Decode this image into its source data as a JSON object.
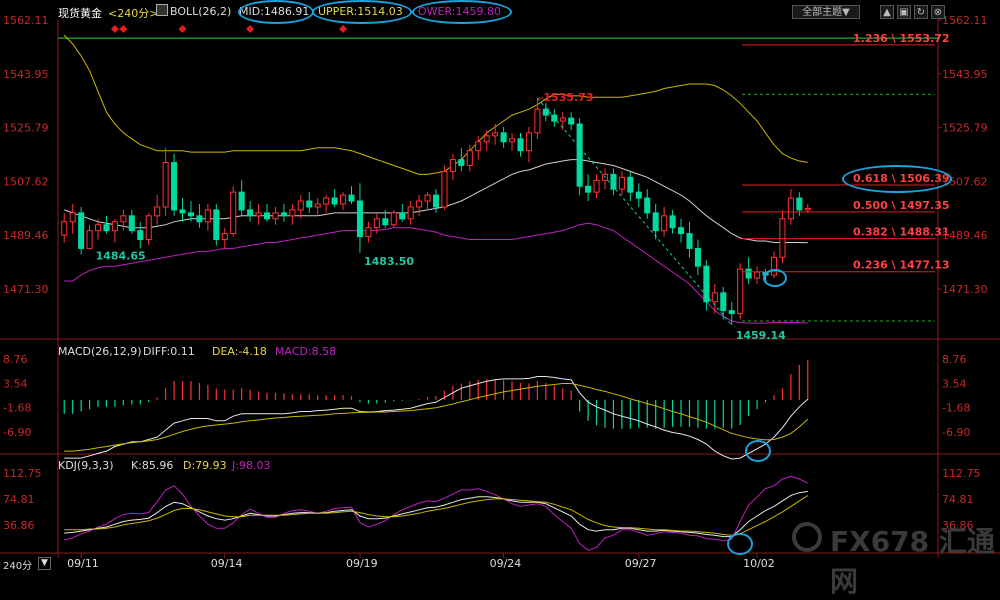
{
  "header": {
    "instrument": "现货黄金",
    "period": "<240分>",
    "indicator_name": "BOLL(26,2)",
    "mid_label": "MID:1486.91",
    "upper_label": "UPPER:1514.03",
    "lower_label": "OWER:1459.80"
  },
  "toolbar": {
    "topic_button": "全部主题▼",
    "button2": "▲",
    "button3": "▣",
    "button4": "↻",
    "button5": "⊗"
  },
  "macd": {
    "label": "MACD(26,12,9)",
    "diff": "DIFF:0.11",
    "dea": "DEA:-4.18",
    "macd": "MACD:8.58"
  },
  "kdj": {
    "label": "KDJ(9,3,3)",
    "k": "K:85.96",
    "d": "D:79.93",
    "j": "J:98.03"
  },
  "period_selector": "240分",
  "watermark": "FX678 汇通网",
  "colors": {
    "up": "#ff3232",
    "down": "#00d9a0",
    "mid": "#cfcfcf",
    "upper": "#c8b800",
    "lower": "#c020c0",
    "axis_text": "#c82828"
  },
  "chart_data": {
    "type": "candlestick",
    "price_axis_ticks": [
      "1562.11",
      "1543.95",
      "1525.79",
      "1507.62",
      "1489.46",
      "1471.30"
    ],
    "macd_axis_ticks": [
      "8.76",
      "3.54",
      "-1.68",
      "-6.90"
    ],
    "kdj_axis_ticks": [
      "112.75",
      "74.81",
      "36.86"
    ],
    "date_labels": [
      "09/11",
      "09/14",
      "09/19",
      "09/24",
      "09/27",
      "10/02"
    ],
    "annotations": {
      "high": "1535.73",
      "low1": "1484.65",
      "low2": "1483.50",
      "low3": "1459.14"
    },
    "fib_levels": [
      {
        "label": "1.236 \\ 1553.72",
        "price": 1553.72
      },
      {
        "label": "0.618 \\ 1506.39",
        "price": 1506.39
      },
      {
        "label": "0.500 \\ 1497.35",
        "price": 1497.35
      },
      {
        "label": "0.382 \\ 1488.31",
        "price": 1488.31
      },
      {
        "label": "0.236 \\ 1477.13",
        "price": 1477.13
      }
    ],
    "green_level": 1556.0,
    "dashed_levels": [
      1537.0,
      1460.5
    ],
    "candles": [
      {
        "o": 1489.5,
        "h": 1497,
        "l": 1487,
        "c": 1494
      },
      {
        "o": 1494,
        "h": 1500,
        "l": 1490,
        "c": 1497
      },
      {
        "o": 1497,
        "h": 1499,
        "l": 1483,
        "c": 1485
      },
      {
        "o": 1485,
        "h": 1493,
        "l": 1484.65,
        "c": 1491
      },
      {
        "o": 1491,
        "h": 1495,
        "l": 1488,
        "c": 1493
      },
      {
        "o": 1493,
        "h": 1496,
        "l": 1490,
        "c": 1491
      },
      {
        "o": 1491,
        "h": 1495,
        "l": 1487,
        "c": 1494
      },
      {
        "o": 1494,
        "h": 1498,
        "l": 1491,
        "c": 1496
      },
      {
        "o": 1496,
        "h": 1498,
        "l": 1490,
        "c": 1491
      },
      {
        "o": 1491,
        "h": 1494,
        "l": 1485,
        "c": 1488
      },
      {
        "o": 1488,
        "h": 1497,
        "l": 1486,
        "c": 1496
      },
      {
        "o": 1496,
        "h": 1503,
        "l": 1493,
        "c": 1499
      },
      {
        "o": 1499,
        "h": 1519,
        "l": 1496,
        "c": 1514
      },
      {
        "o": 1514,
        "h": 1517,
        "l": 1496,
        "c": 1498
      },
      {
        "o": 1498,
        "h": 1502,
        "l": 1494,
        "c": 1497
      },
      {
        "o": 1497,
        "h": 1501,
        "l": 1494,
        "c": 1496
      },
      {
        "o": 1496,
        "h": 1500,
        "l": 1492,
        "c": 1494
      },
      {
        "o": 1494,
        "h": 1500,
        "l": 1491,
        "c": 1498
      },
      {
        "o": 1498,
        "h": 1500,
        "l": 1486,
        "c": 1488
      },
      {
        "o": 1488,
        "h": 1492,
        "l": 1485,
        "c": 1490
      },
      {
        "o": 1490,
        "h": 1506,
        "l": 1489,
        "c": 1504
      },
      {
        "o": 1504,
        "h": 1508,
        "l": 1496,
        "c": 1498
      },
      {
        "o": 1498,
        "h": 1501,
        "l": 1494,
        "c": 1496
      },
      {
        "o": 1496,
        "h": 1500,
        "l": 1493,
        "c": 1497
      },
      {
        "o": 1497,
        "h": 1500,
        "l": 1494,
        "c": 1495
      },
      {
        "o": 1495,
        "h": 1499,
        "l": 1493,
        "c": 1497
      },
      {
        "o": 1497,
        "h": 1500,
        "l": 1494,
        "c": 1496
      },
      {
        "o": 1496,
        "h": 1500,
        "l": 1493,
        "c": 1498
      },
      {
        "o": 1498,
        "h": 1503,
        "l": 1495,
        "c": 1501
      },
      {
        "o": 1501,
        "h": 1504,
        "l": 1497,
        "c": 1499
      },
      {
        "o": 1499,
        "h": 1502,
        "l": 1496,
        "c": 1500
      },
      {
        "o": 1500,
        "h": 1503,
        "l": 1497,
        "c": 1502
      },
      {
        "o": 1502,
        "h": 1505,
        "l": 1499,
        "c": 1500
      },
      {
        "o": 1500,
        "h": 1504,
        "l": 1498,
        "c": 1503
      },
      {
        "o": 1503,
        "h": 1506,
        "l": 1500,
        "c": 1501
      },
      {
        "o": 1501,
        "h": 1507,
        "l": 1483.5,
        "c": 1489
      },
      {
        "o": 1489,
        "h": 1494,
        "l": 1487,
        "c": 1492
      },
      {
        "o": 1492,
        "h": 1497,
        "l": 1490,
        "c": 1495
      },
      {
        "o": 1495,
        "h": 1498,
        "l": 1492,
        "c": 1493
      },
      {
        "o": 1493,
        "h": 1498,
        "l": 1492,
        "c": 1497
      },
      {
        "o": 1497,
        "h": 1500,
        "l": 1494,
        "c": 1495
      },
      {
        "o": 1495,
        "h": 1501,
        "l": 1493,
        "c": 1499
      },
      {
        "o": 1499,
        "h": 1503,
        "l": 1496,
        "c": 1501
      },
      {
        "o": 1501,
        "h": 1504,
        "l": 1498,
        "c": 1503
      },
      {
        "o": 1503,
        "h": 1505,
        "l": 1497,
        "c": 1499
      },
      {
        "o": 1499,
        "h": 1513,
        "l": 1498,
        "c": 1511
      },
      {
        "o": 1511,
        "h": 1517,
        "l": 1508,
        "c": 1515
      },
      {
        "o": 1515,
        "h": 1519,
        "l": 1511,
        "c": 1513
      },
      {
        "o": 1513,
        "h": 1520,
        "l": 1511,
        "c": 1518
      },
      {
        "o": 1518,
        "h": 1523,
        "l": 1515,
        "c": 1521
      },
      {
        "o": 1521,
        "h": 1525,
        "l": 1518,
        "c": 1523
      },
      {
        "o": 1523,
        "h": 1527,
        "l": 1520,
        "c": 1524
      },
      {
        "o": 1524,
        "h": 1526,
        "l": 1519,
        "c": 1521
      },
      {
        "o": 1521,
        "h": 1524,
        "l": 1518,
        "c": 1522
      },
      {
        "o": 1522,
        "h": 1524,
        "l": 1516,
        "c": 1518
      },
      {
        "o": 1518,
        "h": 1526,
        "l": 1514,
        "c": 1524
      },
      {
        "o": 1524,
        "h": 1535.73,
        "l": 1522,
        "c": 1532
      },
      {
        "o": 1532,
        "h": 1534,
        "l": 1528,
        "c": 1530
      },
      {
        "o": 1530,
        "h": 1532,
        "l": 1526,
        "c": 1528
      },
      {
        "o": 1528,
        "h": 1531,
        "l": 1525,
        "c": 1529
      },
      {
        "o": 1529,
        "h": 1531,
        "l": 1525,
        "c": 1527
      },
      {
        "o": 1527,
        "h": 1529,
        "l": 1503,
        "c": 1506
      },
      {
        "o": 1506,
        "h": 1510,
        "l": 1501,
        "c": 1504
      },
      {
        "o": 1504,
        "h": 1510,
        "l": 1502,
        "c": 1508
      },
      {
        "o": 1508,
        "h": 1512,
        "l": 1505,
        "c": 1510
      },
      {
        "o": 1510,
        "h": 1512,
        "l": 1503,
        "c": 1505
      },
      {
        "o": 1505,
        "h": 1511,
        "l": 1503,
        "c": 1509
      },
      {
        "o": 1509,
        "h": 1511,
        "l": 1501,
        "c": 1504
      },
      {
        "o": 1504,
        "h": 1507,
        "l": 1499,
        "c": 1502
      },
      {
        "o": 1502,
        "h": 1505,
        "l": 1495,
        "c": 1497
      },
      {
        "o": 1497,
        "h": 1500,
        "l": 1488,
        "c": 1491
      },
      {
        "o": 1491,
        "h": 1499,
        "l": 1489,
        "c": 1496
      },
      {
        "o": 1496,
        "h": 1498,
        "l": 1490,
        "c": 1492
      },
      {
        "o": 1492,
        "h": 1495,
        "l": 1487,
        "c": 1490
      },
      {
        "o": 1490,
        "h": 1494,
        "l": 1482,
        "c": 1485
      },
      {
        "o": 1485,
        "h": 1488,
        "l": 1476,
        "c": 1479
      },
      {
        "o": 1479,
        "h": 1481,
        "l": 1464,
        "c": 1467
      },
      {
        "o": 1467,
        "h": 1473,
        "l": 1463,
        "c": 1470
      },
      {
        "o": 1470,
        "h": 1472,
        "l": 1461,
        "c": 1464
      },
      {
        "o": 1464,
        "h": 1467,
        "l": 1459.14,
        "c": 1463
      },
      {
        "o": 1463,
        "h": 1480,
        "l": 1461,
        "c": 1478
      },
      {
        "o": 1478,
        "h": 1482,
        "l": 1473,
        "c": 1475
      },
      {
        "o": 1475,
        "h": 1479,
        "l": 1473,
        "c": 1477
      },
      {
        "o": 1477,
        "h": 1478,
        "l": 1474,
        "c": 1476
      },
      {
        "o": 1476,
        "h": 1484,
        "l": 1475,
        "c": 1482
      },
      {
        "o": 1482,
        "h": 1498,
        "l": 1480,
        "c": 1495
      },
      {
        "o": 1495,
        "h": 1505,
        "l": 1493,
        "c": 1502
      },
      {
        "o": 1502,
        "h": 1504,
        "l": 1496,
        "c": 1498
      },
      {
        "o": 1498,
        "h": 1500,
        "l": 1497,
        "c": 1498.5
      }
    ],
    "boll_mid": [
      1498,
      1497,
      1496,
      1495,
      1494,
      1493.5,
      1493,
      1492.5,
      1492,
      1492,
      1492,
      1492.5,
      1493,
      1494,
      1494.5,
      1495,
      1495,
      1495,
      1495,
      1495,
      1495.5,
      1496,
      1496,
      1496,
      1496,
      1496,
      1496,
      1496,
      1496,
      1496,
      1496,
      1496.5,
      1497,
      1497,
      1497,
      1497,
      1497,
      1497,
      1497,
      1497,
      1497,
      1497,
      1497.5,
      1498,
      1498.5,
      1499,
      1500,
      1501,
      1502.5,
      1504,
      1505.5,
      1507,
      1508.5,
      1510,
      1511,
      1511.5,
      1512.5,
      1513.5,
      1514,
      1514.5,
      1515,
      1515,
      1514.5,
      1514,
      1513.5,
      1513,
      1512,
      1511,
      1510,
      1509,
      1507.5,
      1506,
      1504.5,
      1503,
      1501,
      1498.5,
      1496,
      1494,
      1492,
      1490,
      1488.5,
      1488,
      1487.5,
      1487.5,
      1487,
      1487,
      1487,
      1487,
      1486.91
    ],
    "boll_upper": [
      1557,
      1554,
      1550,
      1545,
      1538,
      1531,
      1527,
      1524,
      1522,
      1520,
      1519,
      1518,
      1518,
      1518,
      1518,
      1517.5,
      1517.5,
      1517.5,
      1517.5,
      1517.5,
      1518,
      1518,
      1518,
      1518,
      1518,
      1518,
      1518,
      1518,
      1518,
      1518.5,
      1519,
      1519,
      1519,
      1518.5,
      1518,
      1517,
      1516,
      1515,
      1514,
      1513,
      1512,
      1511,
      1510,
      1510,
      1510.5,
      1511,
      1513,
      1515,
      1518,
      1521,
      1524,
      1526,
      1528,
      1530,
      1531,
      1532,
      1533.5,
      1535.5,
      1537,
      1537,
      1536.5,
      1536.5,
      1536,
      1536,
      1536,
      1536,
      1536,
      1536.5,
      1537,
      1537.5,
      1538,
      1539,
      1539.5,
      1540,
      1540.5,
      1540.5,
      1540.5,
      1540,
      1538.5,
      1536.5,
      1534,
      1531,
      1528,
      1524,
      1520,
      1517,
      1515.5,
      1514.5,
      1514.03
    ],
    "boll_lower": [
      1474,
      1474,
      1476,
      1477.5,
      1478.5,
      1479,
      1479,
      1479.5,
      1480,
      1480.5,
      1481,
      1481.5,
      1482,
      1482.5,
      1483,
      1483.5,
      1484,
      1484,
      1484.5,
      1485,
      1485,
      1485.5,
      1486,
      1486.5,
      1487,
      1487,
      1487.5,
      1488,
      1488.5,
      1489,
      1489.5,
      1490,
      1490.5,
      1491,
      1491,
      1491,
      1491,
      1491,
      1491.5,
      1492,
      1492,
      1492,
      1491.5,
      1491,
      1490.5,
      1489.5,
      1489,
      1488.5,
      1488,
      1488,
      1488,
      1488,
      1488,
      1488,
      1488.5,
      1489,
      1489.5,
      1490,
      1490.5,
      1491,
      1492,
      1493,
      1493.5,
      1493,
      1492,
      1491,
      1489,
      1487,
      1485,
      1483,
      1481,
      1479,
      1477,
      1475,
      1473,
      1470,
      1467,
      1464,
      1462,
      1460.5,
      1460,
      1459.8,
      1459.8,
      1459.8,
      1460,
      1460,
      1460,
      1460,
      1459.8
    ],
    "macd_hist": [
      -3,
      -3,
      -2.5,
      -2,
      -1.5,
      -1.5,
      -1.5,
      -1.2,
      -1,
      -1,
      -0.5,
      0.5,
      2.5,
      4,
      4,
      4,
      3.6,
      3.2,
      2.4,
      2.2,
      2.2,
      2.6,
      2.2,
      1.8,
      1.5,
      1.5,
      1.4,
      1.2,
      1.2,
      1.2,
      1.0,
      1.0,
      1.0,
      1.0,
      0.8,
      -0.5,
      -0.8,
      -0.8,
      -0.6,
      -0.3,
      -0.2,
      -0.1,
      0.2,
      0.6,
      0.8,
      2.0,
      3.0,
      3.5,
      4.0,
      4.3,
      4.4,
      4.4,
      4.2,
      4.0,
      3.6,
      3.5,
      4.0,
      3.6,
      3.0,
      2.5,
      2.0,
      -2.5,
      -4.5,
      -5.5,
      -6,
      -6.2,
      -6.2,
      -6.2,
      -6,
      -6,
      -6.2,
      -6,
      -5.8,
      -5.8,
      -5.8,
      -6,
      -6.2,
      -6.2,
      -6,
      -6.2,
      -5.4,
      -3.5,
      -2,
      -0.5,
      1.0,
      2.5,
      5.5,
      7.5,
      8.58
    ],
    "macd_diff": [
      -12.5,
      -12.5,
      -12.5,
      -12,
      -11.5,
      -11,
      -10,
      -9.5,
      -9,
      -9,
      -8.5,
      -8,
      -6.5,
      -5,
      -4.5,
      -4,
      -4,
      -4,
      -4.5,
      -4.5,
      -3.5,
      -3,
      -3,
      -3,
      -3,
      -3,
      -3,
      -2.8,
      -2.5,
      -2.5,
      -2.3,
      -2.2,
      -2,
      -1.8,
      -1.8,
      -2.5,
      -2.6,
      -2.5,
      -2.3,
      -2.2,
      -2,
      -1.8,
      -1.3,
      -0.8,
      -0.5,
      0.5,
      1.5,
      2.5,
      3,
      3.5,
      4,
      4.3,
      4.5,
      4.5,
      4.5,
      4.6,
      5,
      5,
      4.8,
      4.5,
      4.3,
      1.5,
      -0.5,
      -1.5,
      -2.2,
      -3,
      -3.5,
      -4,
      -4.5,
      -5.2,
      -5.8,
      -6.5,
      -7,
      -7.3,
      -7.8,
      -8.5,
      -9.5,
      -11,
      -12,
      -12.7,
      -12.5,
      -11.5,
      -10.5,
      -9.5,
      -8,
      -6,
      -3.5,
      -1.5,
      0.11
    ],
    "macd_dea": [
      -11,
      -11,
      -10.8,
      -10.6,
      -10.3,
      -10,
      -9.7,
      -9.4,
      -9.2,
      -9,
      -8.8,
      -8.5,
      -8,
      -7.4,
      -6.8,
      -6.3,
      -5.9,
      -5.6,
      -5.4,
      -5.2,
      -5,
      -4.7,
      -4.5,
      -4.3,
      -4.1,
      -3.9,
      -3.8,
      -3.6,
      -3.5,
      -3.4,
      -3.3,
      -3.2,
      -3,
      -2.9,
      -2.8,
      -2.7,
      -2.7,
      -2.6,
      -2.6,
      -2.5,
      -2.4,
      -2.3,
      -2.1,
      -1.9,
      -1.7,
      -1.3,
      -0.9,
      -0.4,
      0,
      0.5,
      0.9,
      1.3,
      1.7,
      2,
      2.3,
      2.6,
      2.9,
      3.1,
      3.3,
      3.5,
      3.5,
      3.1,
      2.7,
      2.2,
      1.8,
      1.3,
      0.8,
      0.2,
      -0.3,
      -0.8,
      -1.3,
      -1.9,
      -2.5,
      -3,
      -3.6,
      -4.2,
      -4.8,
      -5.6,
      -6.4,
      -7.2,
      -7.7,
      -8.1,
      -8.4,
      -8.6,
      -8.5,
      -8,
      -7.2,
      -5.8,
      -4.18
    ],
    "kdj_k": [
      25,
      26,
      28,
      30,
      32,
      34,
      38,
      42,
      44,
      45,
      47,
      55,
      64,
      70,
      68,
      62,
      56,
      50,
      46,
      44,
      46,
      50,
      54,
      52,
      50,
      50,
      52,
      54,
      55,
      55,
      54,
      55,
      57,
      58,
      59,
      50,
      46,
      46,
      47,
      50,
      53,
      56,
      59,
      62,
      63,
      66,
      70,
      74,
      76,
      78,
      78,
      77,
      75,
      72,
      70,
      70,
      70,
      68,
      62,
      56,
      50,
      38,
      30,
      28,
      30,
      30,
      32,
      32,
      30,
      28,
      28,
      29,
      28,
      27,
      26,
      25,
      23,
      22,
      20,
      20,
      30,
      42,
      50,
      58,
      64,
      72,
      80,
      84,
      85.96
    ],
    "kdj_d": [
      30,
      30,
      30,
      31,
      31,
      32,
      34,
      37,
      39,
      41,
      43,
      47,
      52,
      58,
      61,
      61,
      59,
      56,
      53,
      50,
      49,
      49,
      51,
      51,
      51,
      51,
      51,
      52,
      53,
      54,
      54,
      54,
      55,
      56,
      57,
      55,
      52,
      50,
      49,
      49,
      50,
      52,
      54,
      57,
      59,
      61,
      64,
      67,
      70,
      72,
      74,
      75,
      75,
      74,
      73,
      72,
      71,
      70,
      67,
      63,
      59,
      52,
      45,
      40,
      36,
      34,
      33,
      33,
      32,
      31,
      30,
      30,
      29,
      28,
      28,
      27,
      26,
      25,
      23,
      22,
      24,
      30,
      36,
      42,
      49,
      56,
      64,
      72,
      79.93
    ],
    "kdj_j": [
      15,
      18,
      24,
      28,
      34,
      38,
      46,
      52,
      54,
      53,
      55,
      71,
      88,
      94,
      82,
      64,
      50,
      38,
      32,
      32,
      40,
      52,
      60,
      54,
      48,
      48,
      54,
      58,
      59,
      57,
      54,
      57,
      61,
      62,
      63,
      40,
      34,
      38,
      43,
      52,
      59,
      64,
      69,
      72,
      71,
      76,
      82,
      88,
      88,
      90,
      86,
      81,
      75,
      68,
      64,
      66,
      68,
      64,
      52,
      42,
      32,
      10,
      0,
      4,
      18,
      22,
      30,
      30,
      26,
      22,
      24,
      27,
      26,
      25,
      22,
      21,
      17,
      16,
      14,
      16,
      42,
      66,
      78,
      90,
      94,
      104,
      108,
      104,
      98.03
    ]
  }
}
